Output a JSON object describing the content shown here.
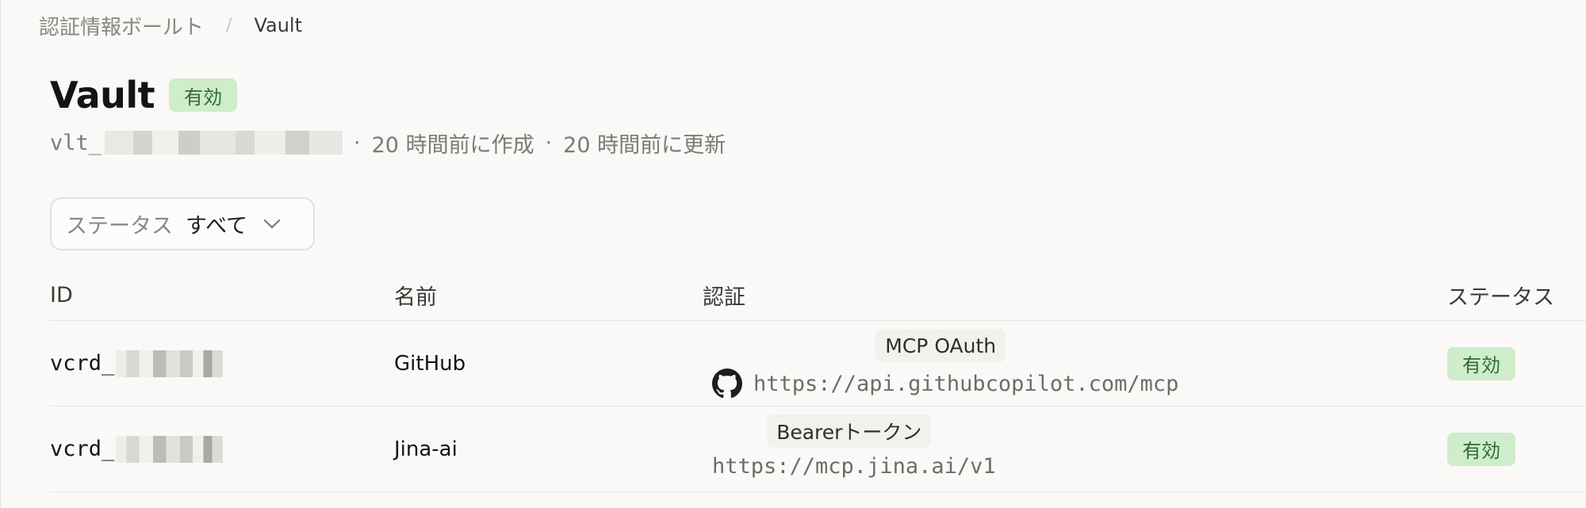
{
  "breadcrumb": {
    "parent": "認証情報ボールト",
    "separator": "/",
    "current": "Vault"
  },
  "header": {
    "title": "Vault",
    "status_badge": "有効",
    "vault_id_prefix": "vlt_",
    "created": "20 時間前に作成",
    "updated": "20 時間前に更新",
    "dot": "·"
  },
  "filter": {
    "label": "ステータス",
    "value": "すべて",
    "icon": "chevron-down-icon"
  },
  "table": {
    "columns": [
      "ID",
      "名前",
      "認証",
      "ステータス"
    ],
    "rows": [
      {
        "id_prefix": "vcrd_",
        "name": "GitHub",
        "auth_type": "MCP OAuth",
        "icon": "github-icon",
        "url": "https://api.githubcopilot.com/mcp",
        "status": "有効"
      },
      {
        "id_prefix": "vcrd_",
        "name": "Jina-ai",
        "auth_type": "Bearerトークン",
        "url": "https://mcp.jina.ai/v1",
        "status": "有効"
      }
    ]
  },
  "colors": {
    "background": "#faf9f7",
    "badge_bg": "#cfeccb",
    "badge_text": "#2f6b2f",
    "text_primary": "#141413",
    "text_muted": "#7d7a75"
  }
}
